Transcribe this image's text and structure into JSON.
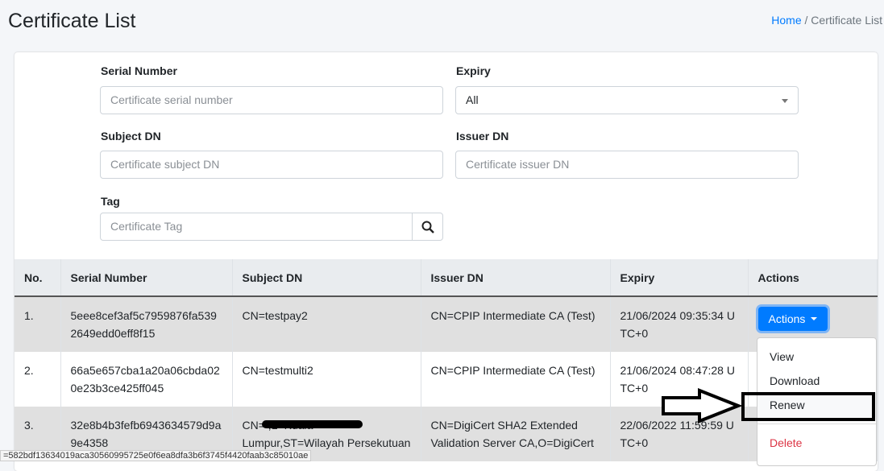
{
  "page": {
    "title": "Certificate List",
    "breadcrumb": {
      "home": "Home",
      "sep": "/",
      "current": "Certificate List"
    }
  },
  "filters": {
    "serial": {
      "label": "Serial Number",
      "placeholder": "Certificate serial number"
    },
    "expiry": {
      "label": "Expiry",
      "value": "All"
    },
    "subject": {
      "label": "Subject DN",
      "placeholder": "Certificate subject DN"
    },
    "issuer": {
      "label": "Issuer DN",
      "placeholder": "Certificate issuer DN"
    },
    "tag": {
      "label": "Tag",
      "placeholder": "Certificate Tag"
    },
    "search_icon": "search-icon"
  },
  "table": {
    "headers": [
      "No.",
      "Serial Number",
      "Subject DN",
      "Issuer DN",
      "Expiry",
      "Actions"
    ],
    "rows": [
      {
        "no": "1.",
        "serial": "5eee8cef3af5c7959876fa5392649edd0eff8f15",
        "subject": "CN=testpay2",
        "issuer": "CN=CPIP Intermediate CA (Test)",
        "expiry": "21/06/2024 09:35:34 UTC+0"
      },
      {
        "no": "2.",
        "serial": "66a5e657cba1a20a06cbda020e23b3ce425ff045",
        "subject": "CN=testmulti2",
        "issuer": "CN=CPIP Intermediate CA (Test)",
        "expiry": "21/06/2024 08:47:28 UTC+0"
      },
      {
        "no": "3.",
        "serial": "32e8b4b3fefb6943634579d9a9e4358",
        "subject": "CN=                    ,L=Kuala Lumpur,ST=Wilayah Persekutuan",
        "issuer": "CN=DigiCert SHA2 Extended Validation Server CA,O=DigiCert",
        "expiry": "22/06/2022 11:59:59 UTC+0"
      }
    ]
  },
  "actions": {
    "button": "Actions",
    "menu": [
      "View",
      "Download",
      "Renew",
      "Delete"
    ]
  },
  "status_bar": "=582bdf13634019aca30560995725e0f6ea8dfa3b6f3745f4420faab3c85010ae",
  "colors": {
    "primary": "#007bff",
    "danger": "#dc3545"
  }
}
